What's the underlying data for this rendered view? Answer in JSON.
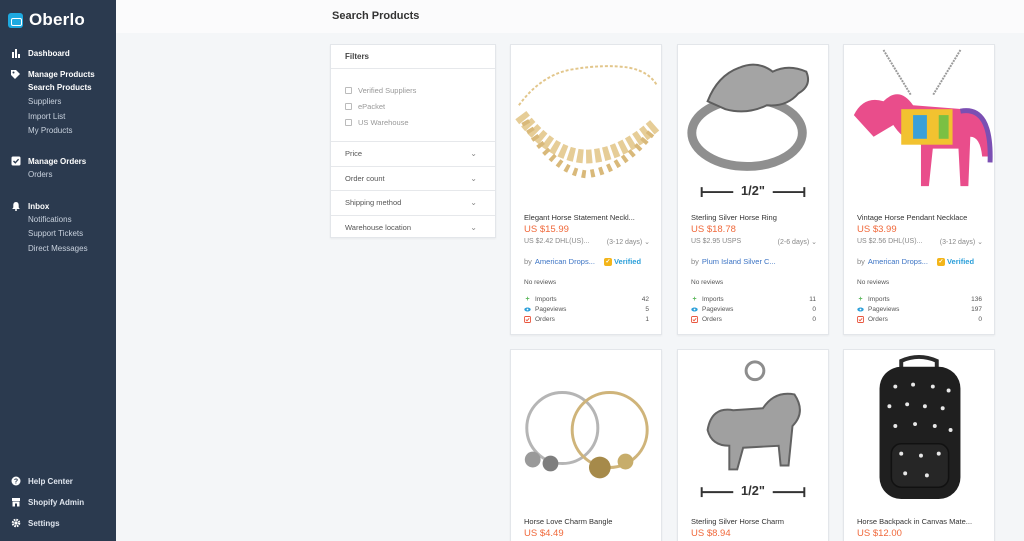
{
  "app": {
    "name": "Oberlo"
  },
  "sidebar": {
    "sections": [
      {
        "label": "Dashboard",
        "icon": "bar-chart-icon",
        "items": []
      },
      {
        "label": "Manage Products",
        "icon": "tag-icon",
        "items": [
          "Search Products",
          "Suppliers",
          "Import List",
          "My Products"
        ]
      },
      {
        "label": "Manage Orders",
        "icon": "check-square-icon",
        "items": [
          "Orders"
        ]
      },
      {
        "label": "Inbox",
        "icon": "bell-icon",
        "items": [
          "Notifications",
          "Support Tickets",
          "Direct Messages"
        ]
      }
    ],
    "bottom": [
      {
        "label": "Help Center",
        "icon": "help-circle-icon"
      },
      {
        "label": "Shopify Admin",
        "icon": "store-icon"
      },
      {
        "label": "Settings",
        "icon": "gear-icon"
      }
    ],
    "active_item": "Search Products"
  },
  "header": {
    "title": "Search Products"
  },
  "filters": {
    "title": "Filters",
    "checkboxes": [
      "Verified Suppliers",
      "ePacket",
      "US Warehouse"
    ],
    "accordions": [
      "Price",
      "Order count",
      "Shipping method",
      "Warehouse location"
    ]
  },
  "stats_labels": {
    "imports": "Imports",
    "pageviews": "Pageviews",
    "orders": "Orders"
  },
  "products": [
    {
      "name": "Elegant Horse Statement Neckl...",
      "price": "US $15.99",
      "shipping": "US $2.42 DHL(US)...",
      "delivery": "(3-12 days)",
      "supplier_prefix": "by",
      "supplier": "American Drops...",
      "verified": "Verified",
      "reviews": "No reviews",
      "imports": "42",
      "pageviews": "5",
      "orders": "1"
    },
    {
      "name": "Sterling Silver Horse Ring",
      "price": "US $18.78",
      "shipping": "US $2.95 USPS",
      "delivery": "(2-6 days)",
      "supplier_prefix": "by",
      "supplier": "Plum Island Silver C...",
      "verified": "",
      "reviews": "No reviews",
      "imports": "11",
      "pageviews": "0",
      "orders": "0"
    },
    {
      "name": "Vintage Horse Pendant Necklace",
      "price": "US $3.99",
      "shipping": "US $2.56 DHL(US)...",
      "delivery": "(3-12 days)",
      "supplier_prefix": "by",
      "supplier": "American Drops...",
      "verified": "Verified",
      "reviews": "No reviews",
      "imports": "136",
      "pageviews": "197",
      "orders": "0"
    },
    {
      "name": "Horse Love Charm Bangle",
      "price": "US $4.49"
    },
    {
      "name": "Sterling Silver Horse Charm",
      "price": "US $8.94"
    },
    {
      "name": "Horse Backpack in Canvas Mate...",
      "price": "US $12.00"
    }
  ],
  "image_labels": {
    "ring_size": "1/2\"",
    "charm_size": "1/2\""
  },
  "colors": {
    "sidebar": "#2b3a4f",
    "price": "#f0693b",
    "link": "#3b73c4",
    "verified": "#2b9fd9",
    "verified_badge": "#f3b51a"
  }
}
